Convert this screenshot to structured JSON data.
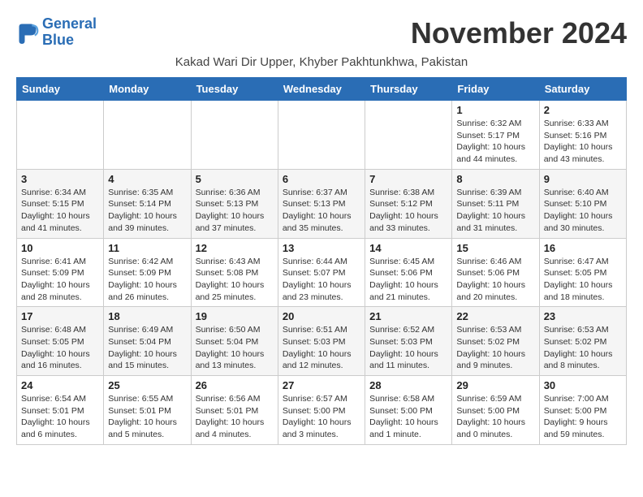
{
  "header": {
    "logo_line1": "General",
    "logo_line2": "Blue",
    "month_title": "November 2024",
    "subtitle": "Kakad Wari Dir Upper, Khyber Pakhtunkhwa, Pakistan"
  },
  "weekdays": [
    "Sunday",
    "Monday",
    "Tuesday",
    "Wednesday",
    "Thursday",
    "Friday",
    "Saturday"
  ],
  "weeks": [
    [
      {
        "day": "",
        "info": ""
      },
      {
        "day": "",
        "info": ""
      },
      {
        "day": "",
        "info": ""
      },
      {
        "day": "",
        "info": ""
      },
      {
        "day": "",
        "info": ""
      },
      {
        "day": "1",
        "info": "Sunrise: 6:32 AM\nSunset: 5:17 PM\nDaylight: 10 hours\nand 44 minutes."
      },
      {
        "day": "2",
        "info": "Sunrise: 6:33 AM\nSunset: 5:16 PM\nDaylight: 10 hours\nand 43 minutes."
      }
    ],
    [
      {
        "day": "3",
        "info": "Sunrise: 6:34 AM\nSunset: 5:15 PM\nDaylight: 10 hours\nand 41 minutes."
      },
      {
        "day": "4",
        "info": "Sunrise: 6:35 AM\nSunset: 5:14 PM\nDaylight: 10 hours\nand 39 minutes."
      },
      {
        "day": "5",
        "info": "Sunrise: 6:36 AM\nSunset: 5:13 PM\nDaylight: 10 hours\nand 37 minutes."
      },
      {
        "day": "6",
        "info": "Sunrise: 6:37 AM\nSunset: 5:13 PM\nDaylight: 10 hours\nand 35 minutes."
      },
      {
        "day": "7",
        "info": "Sunrise: 6:38 AM\nSunset: 5:12 PM\nDaylight: 10 hours\nand 33 minutes."
      },
      {
        "day": "8",
        "info": "Sunrise: 6:39 AM\nSunset: 5:11 PM\nDaylight: 10 hours\nand 31 minutes."
      },
      {
        "day": "9",
        "info": "Sunrise: 6:40 AM\nSunset: 5:10 PM\nDaylight: 10 hours\nand 30 minutes."
      }
    ],
    [
      {
        "day": "10",
        "info": "Sunrise: 6:41 AM\nSunset: 5:09 PM\nDaylight: 10 hours\nand 28 minutes."
      },
      {
        "day": "11",
        "info": "Sunrise: 6:42 AM\nSunset: 5:09 PM\nDaylight: 10 hours\nand 26 minutes."
      },
      {
        "day": "12",
        "info": "Sunrise: 6:43 AM\nSunset: 5:08 PM\nDaylight: 10 hours\nand 25 minutes."
      },
      {
        "day": "13",
        "info": "Sunrise: 6:44 AM\nSunset: 5:07 PM\nDaylight: 10 hours\nand 23 minutes."
      },
      {
        "day": "14",
        "info": "Sunrise: 6:45 AM\nSunset: 5:06 PM\nDaylight: 10 hours\nand 21 minutes."
      },
      {
        "day": "15",
        "info": "Sunrise: 6:46 AM\nSunset: 5:06 PM\nDaylight: 10 hours\nand 20 minutes."
      },
      {
        "day": "16",
        "info": "Sunrise: 6:47 AM\nSunset: 5:05 PM\nDaylight: 10 hours\nand 18 minutes."
      }
    ],
    [
      {
        "day": "17",
        "info": "Sunrise: 6:48 AM\nSunset: 5:05 PM\nDaylight: 10 hours\nand 16 minutes."
      },
      {
        "day": "18",
        "info": "Sunrise: 6:49 AM\nSunset: 5:04 PM\nDaylight: 10 hours\nand 15 minutes."
      },
      {
        "day": "19",
        "info": "Sunrise: 6:50 AM\nSunset: 5:04 PM\nDaylight: 10 hours\nand 13 minutes."
      },
      {
        "day": "20",
        "info": "Sunrise: 6:51 AM\nSunset: 5:03 PM\nDaylight: 10 hours\nand 12 minutes."
      },
      {
        "day": "21",
        "info": "Sunrise: 6:52 AM\nSunset: 5:03 PM\nDaylight: 10 hours\nand 11 minutes."
      },
      {
        "day": "22",
        "info": "Sunrise: 6:53 AM\nSunset: 5:02 PM\nDaylight: 10 hours\nand 9 minutes."
      },
      {
        "day": "23",
        "info": "Sunrise: 6:53 AM\nSunset: 5:02 PM\nDaylight: 10 hours\nand 8 minutes."
      }
    ],
    [
      {
        "day": "24",
        "info": "Sunrise: 6:54 AM\nSunset: 5:01 PM\nDaylight: 10 hours\nand 6 minutes."
      },
      {
        "day": "25",
        "info": "Sunrise: 6:55 AM\nSunset: 5:01 PM\nDaylight: 10 hours\nand 5 minutes."
      },
      {
        "day": "26",
        "info": "Sunrise: 6:56 AM\nSunset: 5:01 PM\nDaylight: 10 hours\nand 4 minutes."
      },
      {
        "day": "27",
        "info": "Sunrise: 6:57 AM\nSunset: 5:00 PM\nDaylight: 10 hours\nand 3 minutes."
      },
      {
        "day": "28",
        "info": "Sunrise: 6:58 AM\nSunset: 5:00 PM\nDaylight: 10 hours\nand 1 minute."
      },
      {
        "day": "29",
        "info": "Sunrise: 6:59 AM\nSunset: 5:00 PM\nDaylight: 10 hours\nand 0 minutes."
      },
      {
        "day": "30",
        "info": "Sunrise: 7:00 AM\nSunset: 5:00 PM\nDaylight: 9 hours\nand 59 minutes."
      }
    ]
  ]
}
